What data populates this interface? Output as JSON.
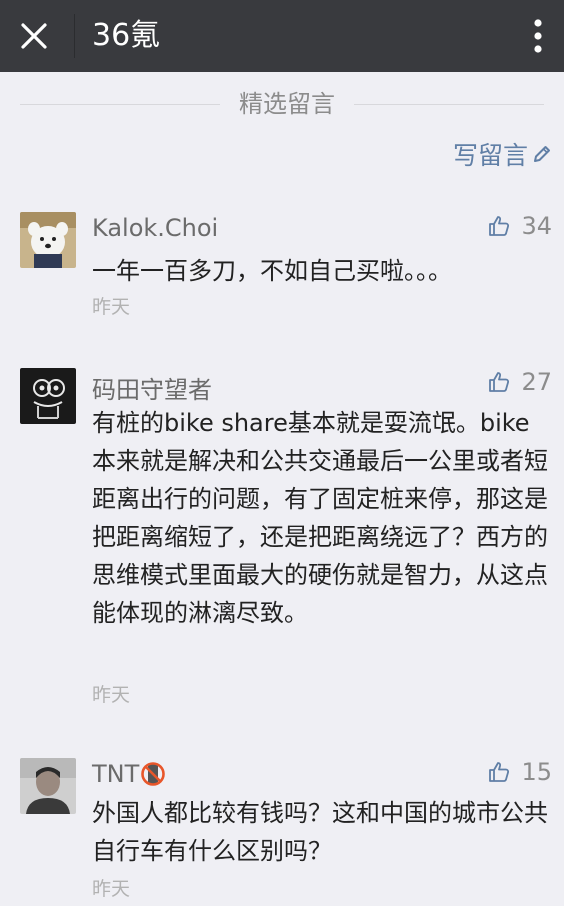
{
  "header": {
    "title": "36氪"
  },
  "section": {
    "title": "精选留言"
  },
  "write_comment": {
    "label": "写留言"
  },
  "comments": [
    {
      "nickname": "Kalok.Choi",
      "likes": "34",
      "content": "一年一百多刀，不如自己买啦。。。",
      "time": "昨天",
      "avatar": "dog-avatar"
    },
    {
      "nickname": "码田守望者",
      "likes": "27",
      "content": "有桩的bike share基本就是耍流氓。bike本来就是解决和公共交通最后一公里或者短距离出行的问题，有了固定桩来停，那这是把距离缩短了，还是把距离绕远了？西方的思维模式里面最大的硬伤就是智力，从这点能体现的淋漓尽致。",
      "time": "昨天",
      "avatar": "neon-character-avatar"
    },
    {
      "nickname": "TNT",
      "likes": "15",
      "content": "外国人都比较有钱吗？这和中国的城市公共自行车有什么区别吗？",
      "time": "昨天",
      "avatar": "person-photo-avatar"
    }
  ],
  "colors": {
    "topbar": "#393a3e",
    "background": "#efeff4",
    "link": "#607fa6",
    "text": "#222222",
    "meta": "#b2b2b2"
  }
}
